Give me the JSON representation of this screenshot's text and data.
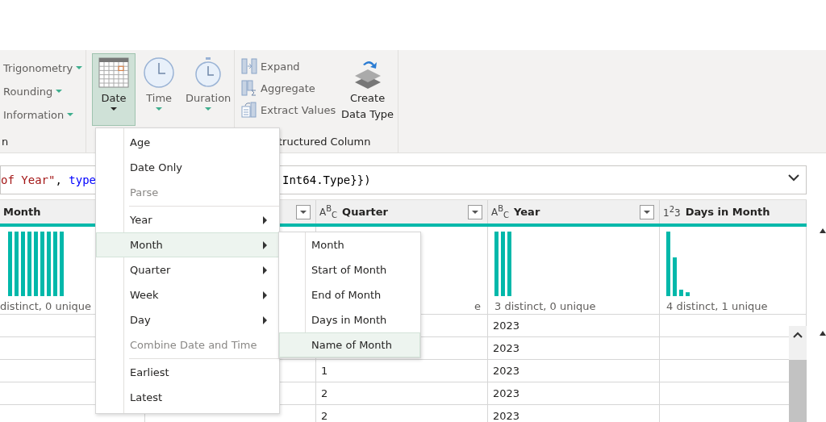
{
  "ribbon": {
    "math_items": [
      {
        "label": "Trigonometry"
      },
      {
        "label": "Rounding"
      },
      {
        "label": "Information"
      }
    ],
    "math_group_label": "n",
    "date_buttons": [
      {
        "label": "Date",
        "kind": "calendar",
        "selected": true
      },
      {
        "label": "Time",
        "kind": "clock",
        "selected": false
      },
      {
        "label": "Duration",
        "kind": "stopwatch",
        "selected": false
      }
    ],
    "structured_items": [
      {
        "label": "Expand"
      },
      {
        "label": "Aggregate"
      },
      {
        "label": "Extract Values"
      }
    ],
    "create_button": "Create Data Type",
    "structured_group_label": "tructured Column"
  },
  "formula_bar": {
    "start": [
      {
        "text": "of Year\"",
        "kind": "string"
      },
      {
        "text": ", ",
        "kind": "plain"
      },
      {
        "text": "type",
        "kind": "keyword"
      }
    ],
    "end": [
      {
        "text": "Int64.Type}})",
        "kind": "plain"
      }
    ]
  },
  "table": {
    "columns": [
      {
        "label": "Month",
        "profile": "distinct, 0 unique",
        "histogram": {
          "kind": "many"
        }
      },
      {},
      {
        "label": "Quarter",
        "type_icon": "A$^{B}$$_{C}$",
        "filter": true,
        "profile": "e"
      },
      {
        "label": "Year",
        "type_icon": "A$^{B}$$_{C}$",
        "filter": true,
        "profile": "3 distinct, 0 unique",
        "histogram": {
          "kind": "three"
        }
      },
      {
        "label": "Days in Month",
        "type_icon": "1$^{2}$3",
        "profile": "4 distinct, 1 unique",
        "histogram": {
          "kind": "falling"
        }
      }
    ],
    "rows": [
      [
        "",
        "",
        "",
        "2023",
        ""
      ],
      [
        "",
        "",
        "",
        "2023",
        ""
      ],
      [
        "",
        "",
        "1",
        "2023",
        ""
      ],
      [
        "",
        "",
        "2",
        "2023",
        ""
      ],
      [
        "",
        "",
        "2",
        "2023",
        ""
      ]
    ]
  },
  "menu": {
    "items": [
      {
        "label": "Age",
        "kind": "item",
        "disabled": false,
        "submenu": false,
        "selected": false
      },
      {
        "label": "Date Only",
        "kind": "item",
        "disabled": false,
        "submenu": false,
        "selected": false
      },
      {
        "label": "Parse",
        "kind": "item",
        "disabled": true,
        "submenu": false,
        "selected": false
      },
      {
        "kind": "separator"
      },
      {
        "label": "Year",
        "kind": "item",
        "disabled": false,
        "submenu": true,
        "selected": false
      },
      {
        "label": "Month",
        "kind": "item",
        "disabled": false,
        "submenu": true,
        "selected": true
      },
      {
        "label": "Quarter",
        "kind": "item",
        "disabled": false,
        "submenu": true,
        "selected": false
      },
      {
        "label": "Week",
        "kind": "item",
        "disabled": false,
        "submenu": true,
        "selected": false
      },
      {
        "label": "Day",
        "kind": "item",
        "disabled": false,
        "submenu": true,
        "selected": false
      },
      {
        "label": "Combine Date and Time",
        "kind": "item",
        "disabled": true,
        "submenu": false,
        "selected": false
      },
      {
        "kind": "separator"
      },
      {
        "label": "Earliest",
        "kind": "item",
        "disabled": false,
        "submenu": false,
        "selected": false
      },
      {
        "label": "Latest",
        "kind": "item",
        "disabled": false,
        "submenu": false,
        "selected": false
      }
    ]
  },
  "submenu": {
    "items": [
      {
        "label": "Month",
        "selected": false
      },
      {
        "label": "Start of Month",
        "selected": false
      },
      {
        "label": "End of Month",
        "selected": false
      },
      {
        "label": "Days in Month",
        "selected": false
      },
      {
        "label": "Name of Month",
        "selected": true
      }
    ]
  }
}
